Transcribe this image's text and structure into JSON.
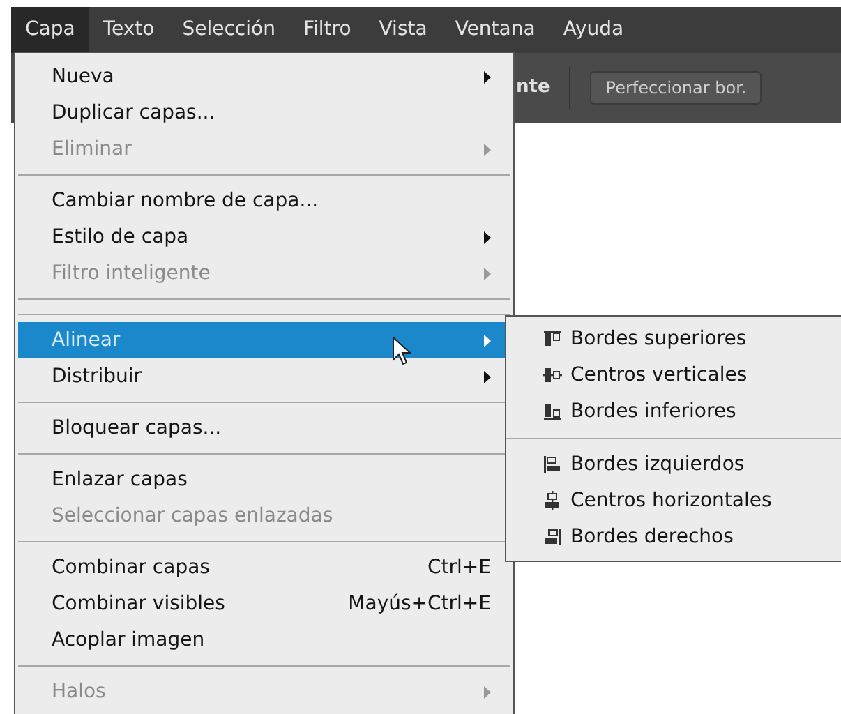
{
  "menubar": [
    {
      "label": "Capa",
      "selected": true
    },
    {
      "label": "Texto",
      "selected": false
    },
    {
      "label": "Selección",
      "selected": false
    },
    {
      "label": "Filtro",
      "selected": false
    },
    {
      "label": "Vista",
      "selected": false
    },
    {
      "label": "Ventana",
      "selected": false
    },
    {
      "label": "Ayuda",
      "selected": false
    }
  ],
  "toolbar": {
    "partial_label": "nte",
    "button": "Perfeccionar bor."
  },
  "menu": [
    {
      "kind": "item",
      "label": "Nueva",
      "submenu": true,
      "disabled": false,
      "selected": false
    },
    {
      "kind": "item",
      "label": "Duplicar capas...",
      "submenu": false,
      "disabled": false,
      "selected": false
    },
    {
      "kind": "item",
      "label": "Eliminar",
      "submenu": true,
      "disabled": true,
      "selected": false
    },
    {
      "kind": "separator"
    },
    {
      "kind": "item",
      "label": "Cambiar nombre de capa...",
      "submenu": false,
      "disabled": false,
      "selected": false
    },
    {
      "kind": "item",
      "label": "Estilo de capa",
      "submenu": true,
      "disabled": false,
      "selected": false
    },
    {
      "kind": "item",
      "label": "Filtro inteligente",
      "submenu": true,
      "disabled": true,
      "selected": false
    },
    {
      "kind": "separator"
    },
    {
      "kind": "separator"
    },
    {
      "kind": "item",
      "label": "Alinear",
      "submenu": true,
      "disabled": false,
      "selected": true
    },
    {
      "kind": "item",
      "label": "Distribuir",
      "submenu": true,
      "disabled": false,
      "selected": false
    },
    {
      "kind": "separator"
    },
    {
      "kind": "item",
      "label": "Bloquear capas...",
      "submenu": false,
      "disabled": false,
      "selected": false
    },
    {
      "kind": "separator"
    },
    {
      "kind": "item",
      "label": "Enlazar capas",
      "submenu": false,
      "disabled": false,
      "selected": false
    },
    {
      "kind": "item",
      "label": "Seleccionar capas enlazadas",
      "submenu": false,
      "disabled": true,
      "selected": false
    },
    {
      "kind": "separator"
    },
    {
      "kind": "item",
      "label": "Combinar capas",
      "shortcut": "Ctrl+E",
      "submenu": false,
      "disabled": false,
      "selected": false
    },
    {
      "kind": "item",
      "label": "Combinar visibles",
      "shortcut": "Mayús+Ctrl+E",
      "submenu": false,
      "disabled": false,
      "selected": false
    },
    {
      "kind": "item",
      "label": "Acoplar imagen",
      "submenu": false,
      "disabled": false,
      "selected": false
    },
    {
      "kind": "separator"
    },
    {
      "kind": "item",
      "label": "Halos",
      "submenu": true,
      "disabled": true,
      "selected": false
    }
  ],
  "submenu": [
    {
      "kind": "item",
      "label": "Bordes superiores"
    },
    {
      "kind": "item",
      "label": "Centros verticales"
    },
    {
      "kind": "item",
      "label": "Bordes inferiores"
    },
    {
      "kind": "separator"
    },
    {
      "kind": "item",
      "label": "Bordes izquierdos"
    },
    {
      "kind": "item",
      "label": "Centros horizontales"
    },
    {
      "kind": "item",
      "label": "Bordes derechos"
    }
  ]
}
